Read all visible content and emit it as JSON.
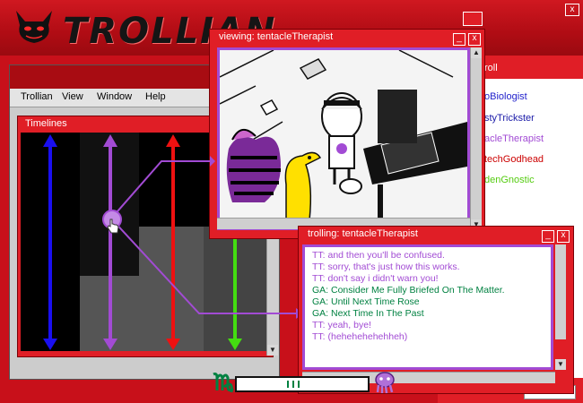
{
  "app": {
    "title": "TROLLIAN",
    "close_glyph": "x"
  },
  "main_window": {
    "menu": [
      "Trollian",
      "View",
      "Window",
      "Help"
    ],
    "timelines_title": "Timelines"
  },
  "timelines": {
    "columns": [
      {
        "color": "#1a0ff0"
      },
      {
        "color": "#a24bd4"
      },
      {
        "color": "#ee1111"
      },
      {
        "color": "#555555"
      },
      {
        "color": "#44dd11"
      }
    ]
  },
  "viewing_window": {
    "title": "viewing: tentacleTherapist"
  },
  "chumroll": {
    "header": "roll",
    "items": [
      {
        "label": "oBiologist",
        "color": "#2222cc"
      },
      {
        "label": "styTrickster",
        "color": "#1a1aa8"
      },
      {
        "label": "acleTherapist",
        "color": "#a24bd4"
      },
      {
        "label": "techGodhead",
        "color": "#cc0000"
      },
      {
        "label": "denGnostic",
        "color": "#55cc11"
      }
    ]
  },
  "chat_window": {
    "title": "trolling: tentacleTherapist",
    "messages": [
      {
        "text": "TT: and then you'll be confused.",
        "color": "#a24bd4"
      },
      {
        "text": "TT: sorry, that's just how this works.",
        "color": "#a24bd4"
      },
      {
        "text": "TT: don't say i didn't warn you!",
        "color": "#a24bd4"
      },
      {
        "text": "GA: Consider Me Fully Briefed On The Matter.",
        "color": "#008141"
      },
      {
        "text": "GA: Until Next Time Rose",
        "color": "#008141"
      },
      {
        "text": "GA: Next Time In The Past",
        "color": "#008141"
      },
      {
        "text": "TT: yeah, bye!",
        "color": "#a24bd4"
      },
      {
        "text": "TT: (hehehehehehheh)",
        "color": "#a24bd4"
      }
    ]
  },
  "icons": {
    "virgo": "virgo-icon",
    "squid": "squiddle-icon"
  }
}
